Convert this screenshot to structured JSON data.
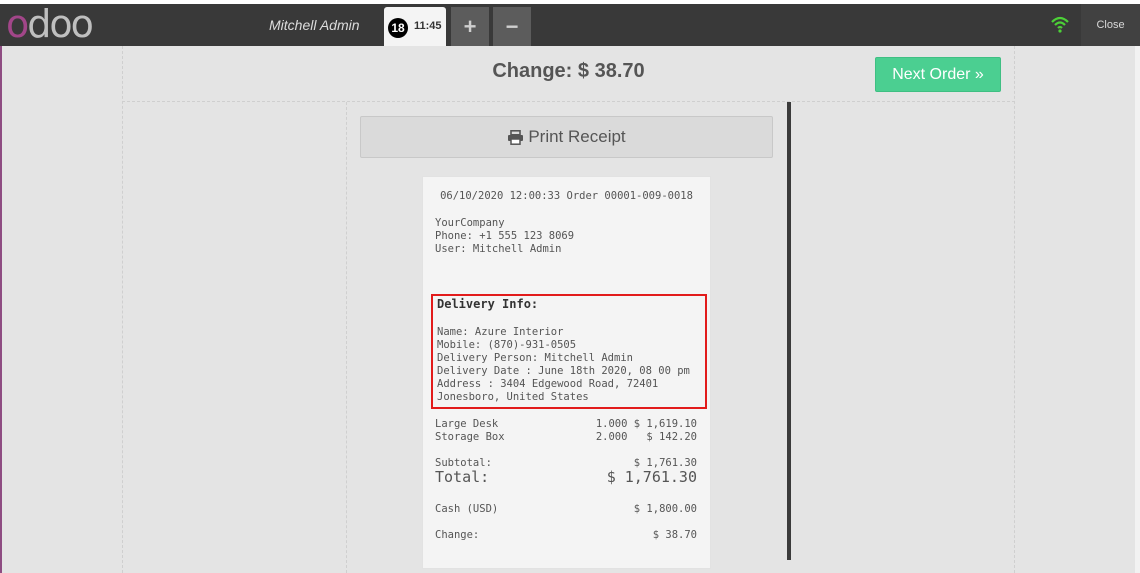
{
  "navbar": {
    "logo_first": "o",
    "logo_rest": "doo",
    "username": "Mitchell Admin",
    "order_tab": {
      "number": "18",
      "time": "11:45"
    },
    "add_label": "+",
    "remove_label": "−",
    "close_label": "Close"
  },
  "colors": {
    "accent": "#4bcf91",
    "logo": "#a24689",
    "highlight": "#e21b1b",
    "wifi": "#4cd137"
  },
  "header": {
    "change_text": "Change: $ 38.70",
    "next_order_label": "Next Order »"
  },
  "print_button": {
    "label": "Print Receipt",
    "icon": "printer-icon"
  },
  "receipt": {
    "header_line": "06/10/2020 12:00:33 Order 00001-009-0018",
    "company": "YourCompany",
    "phone": "Phone: +1 555 123 8069",
    "user": "User: Mitchell Admin",
    "delivery": {
      "title": "Delivery Info:",
      "name": "Name: Azure Interior",
      "mobile": "Mobile: (870)-931-0505",
      "person": "Delivery Person: Mitchell Admin",
      "date": "Delivery Date : June 18th 2020, 08 00 pm",
      "address_line1": "Address : 3404 Edgewood Road, 72401",
      "address_line2": "Jonesboro, United States"
    },
    "lines": [
      {
        "name": "Large Desk",
        "qty_price": "1.000 $ 1,619.10"
      },
      {
        "name": "Storage Box",
        "qty_price": "2.000   $ 142.20"
      }
    ],
    "subtotal_label": "Subtotal:",
    "subtotal_value": "$ 1,761.30",
    "total_label": "Total:",
    "total_value": "$ 1,761.30",
    "cash_label": "Cash (USD)",
    "cash_value": "$ 1,800.00",
    "change_label": "Change:",
    "change_value": "$ 38.70"
  }
}
